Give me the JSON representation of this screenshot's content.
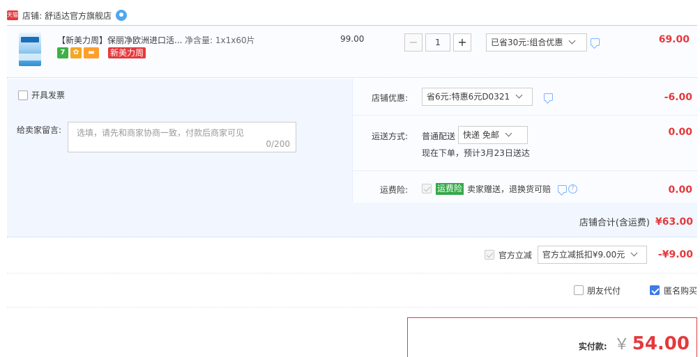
{
  "store": {
    "badge": "天猫",
    "label": "店铺:",
    "name": "舒适达官方旗舰店"
  },
  "product": {
    "title": "【新美力周】保丽净欧洲进口活...",
    "spec": "净含量: 1x1x60片",
    "icon_seven": "7",
    "promo_tag": "新美力周",
    "unit_price": "99.00",
    "quantity": "1",
    "discount_option": "已省30元:组合优惠",
    "total": "69.00"
  },
  "invoice_label": "开具发票",
  "note": {
    "label": "给卖家留言:",
    "placeholder": "选填，请先和商家协商一致，付款后商家可见",
    "count": "0/200"
  },
  "coupon": {
    "label": "店铺优惠:",
    "option": "省6元:特惠6元D0321",
    "amount": "-6.00"
  },
  "shipping": {
    "label": "运送方式:",
    "type": "普通配送",
    "option": "快递 免邮",
    "note": "现在下单，预计3月23日送达",
    "amount": "0.00"
  },
  "insurance": {
    "label": "运费险:",
    "badge": "运费险",
    "text": "卖家赠送，退换货可赔",
    "amount": "0.00"
  },
  "store_total": {
    "label": "店铺合计(含运费)",
    "value": "¥63.00"
  },
  "official": {
    "label": "官方立减",
    "option": "官方立减抵扣¥9.00元",
    "amount": "-¥9.00"
  },
  "extras": {
    "friend_pay": "朋友代付",
    "anonymous": "匿名购买"
  },
  "pay": {
    "label": "实付款:",
    "currency": "￥",
    "value": "54.00"
  },
  "colors": {
    "accent_red": "#e4393c",
    "blue_border": "#b2d1ff",
    "checkbox_blue": "#3d7be8",
    "insurance_green": "#35a848"
  }
}
